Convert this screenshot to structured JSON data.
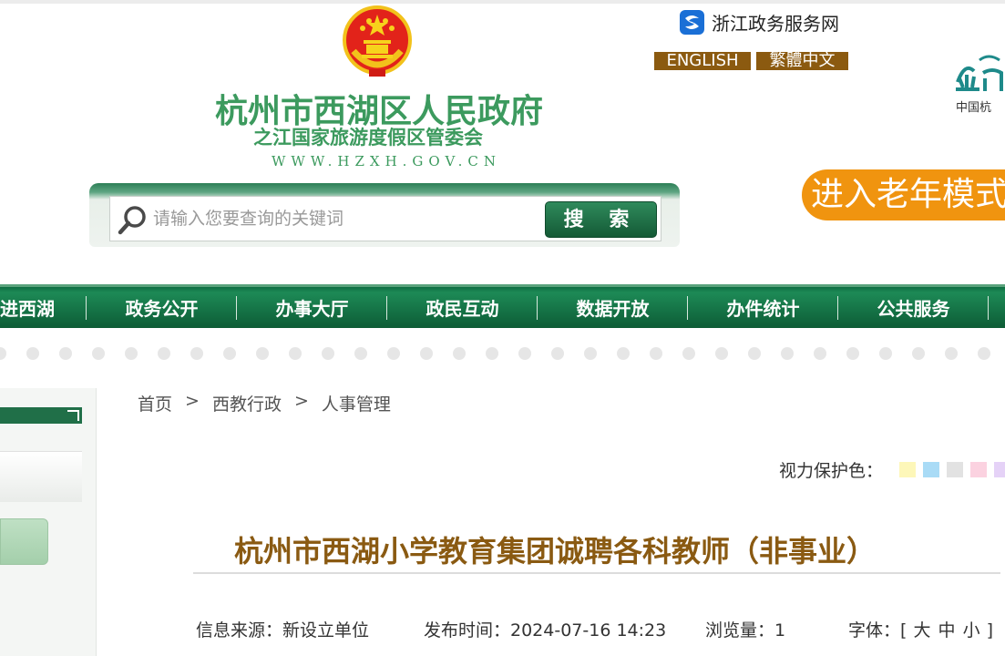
{
  "header": {
    "site_title": "杭州市西湖区人民政府",
    "site_subtitle": "之江国家旅游度假区管委会",
    "site_url": "WWW.HZXH.GOV.CN",
    "zj_service": "浙江政务服务网",
    "lang_english": "ENGLISH",
    "lang_traditional": "繁體中文",
    "right_logo_text": "中国杭"
  },
  "search": {
    "placeholder": "请输入您要查询的关键词",
    "button_label": "搜 索"
  },
  "elder_mode": "进入老年模式",
  "nav": {
    "items": [
      "进西湖",
      "政务公开",
      "办事大厅",
      "政民互动",
      "数据开放",
      "办件统计",
      "公共服务"
    ]
  },
  "breadcrumb": {
    "items": [
      "首页",
      "西教行政",
      "人事管理"
    ],
    "separator": ">"
  },
  "eye_protection": {
    "label": "视力保护色：",
    "colors": [
      "#fdf7b9",
      "#a9dbf6",
      "#e2e2e2",
      "#fbd2e0",
      "#e5d2f7"
    ]
  },
  "article": {
    "title": "杭州市西湖小学教育集团诚聘各科教师（非事业）",
    "source_label": "信息来源：新设立单位",
    "publish_label": "发布时间：2024-07-16 14:23",
    "views_label": "浏览量：1",
    "font_label": "字体：[",
    "font_large": "大",
    "font_medium": "中",
    "font_small": "小",
    "font_close": "]"
  },
  "colors": {
    "brand_green": "#3c9a5e",
    "nav_green": "#0f6d42",
    "title_brown": "#8a5a12",
    "elder_orange": "#f0940f"
  }
}
